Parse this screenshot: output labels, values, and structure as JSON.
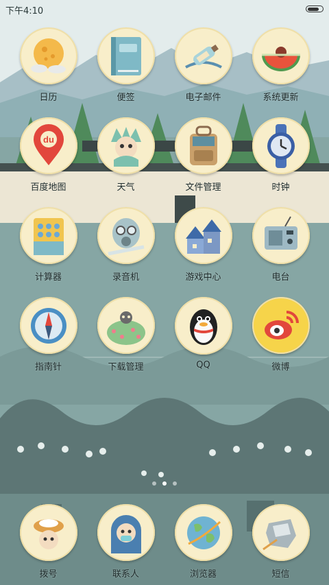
{
  "status_bar": {
    "time": "下午4:10",
    "battery_level": 0.85
  },
  "apps": [
    {
      "label": "日历",
      "icon": "calendar-moon-icon"
    },
    {
      "label": "便签",
      "icon": "notebook-icon"
    },
    {
      "label": "电子邮件",
      "icon": "message-bottle-icon"
    },
    {
      "label": "系统更新",
      "icon": "watermelon-icon"
    },
    {
      "label": "百度地图",
      "icon": "map-pin-icon"
    },
    {
      "label": "天气",
      "icon": "weather-character-icon"
    },
    {
      "label": "文件管理",
      "icon": "backpack-icon"
    },
    {
      "label": "时钟",
      "icon": "wristwatch-icon"
    },
    {
      "label": "计算器",
      "icon": "calculator-icon"
    },
    {
      "label": "录音机",
      "icon": "gas-mask-icon"
    },
    {
      "label": "游戏中心",
      "icon": "houses-icon"
    },
    {
      "label": "电台",
      "icon": "radio-icon"
    },
    {
      "label": "指南针",
      "icon": "compass-icon"
    },
    {
      "label": "下载管理",
      "icon": "bush-cat-icon"
    },
    {
      "label": "QQ",
      "icon": "penguin-icon"
    },
    {
      "label": "微博",
      "icon": "weibo-eye-icon"
    }
  ],
  "dock": [
    {
      "label": "拨号",
      "icon": "nest-character-icon"
    },
    {
      "label": "联系人",
      "icon": "hooded-character-icon"
    },
    {
      "label": "浏览器",
      "icon": "globe-icon"
    },
    {
      "label": "短信",
      "icon": "paper-stone-icon"
    }
  ],
  "page_indicator": {
    "total": 3,
    "active": 2
  },
  "colors": {
    "icon_background": "#f8eeca",
    "sky": "#dbe8ea",
    "water": "#86a6a4"
  }
}
